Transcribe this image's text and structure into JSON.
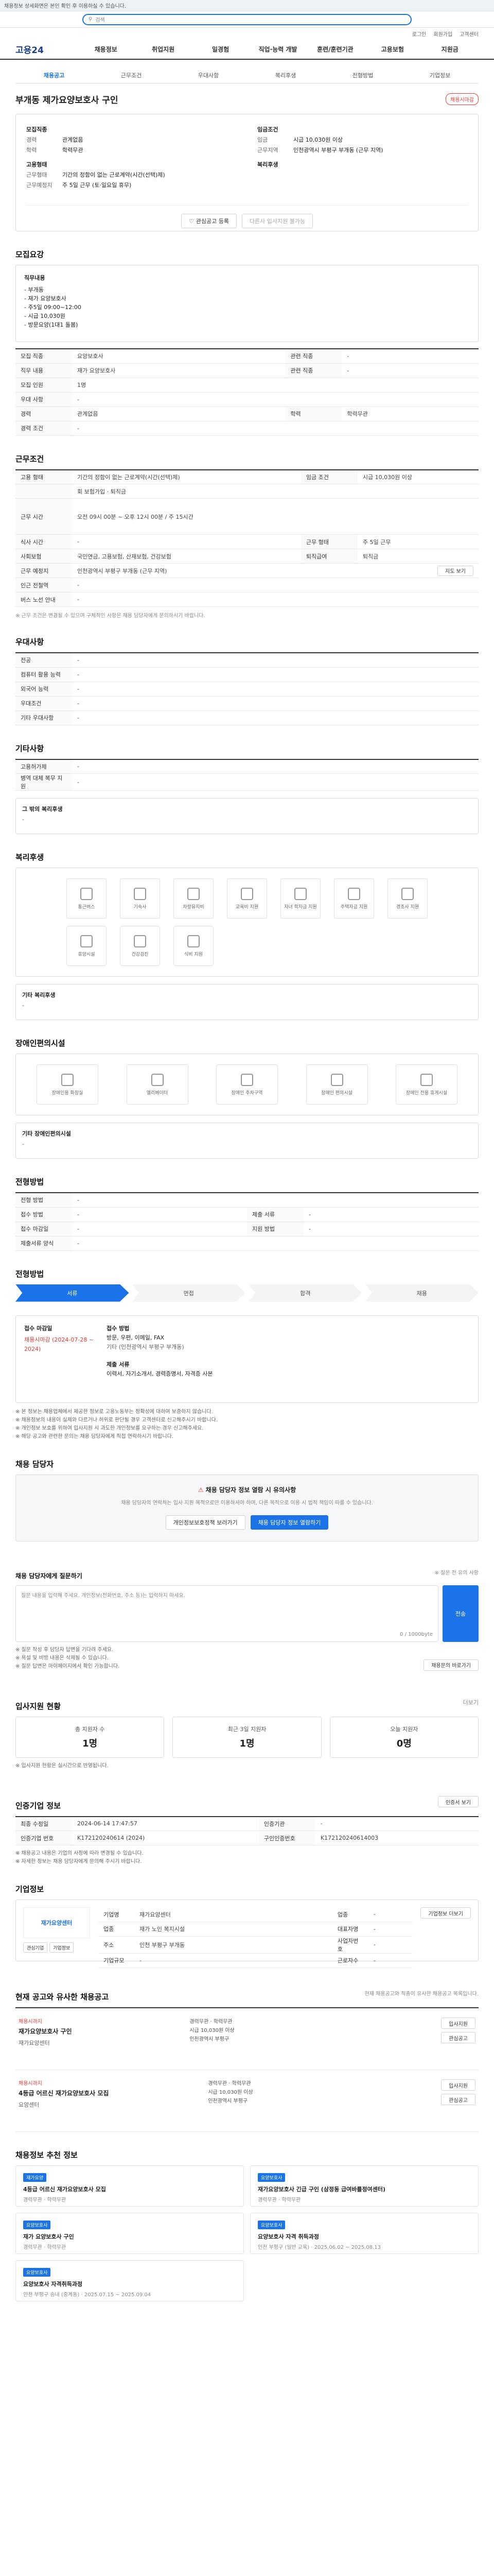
{
  "notice": {
    "text": "채용정보 상세화면은 본인 확인 후 이용하실 수 있습니다."
  },
  "search": {
    "placeholder": "검색"
  },
  "util": {
    "items": [
      "로그인",
      "회원가입",
      "고객센터"
    ]
  },
  "gnb": {
    "logo": "고용24",
    "items": [
      "채용정보",
      "취업지원",
      "일경험",
      "직업·능력 개발",
      "훈련/훈련기관",
      "고용보험",
      "지원금"
    ]
  },
  "header": {
    "tabs": [
      "채용공고",
      "근무조건",
      "우대사항",
      "복리후생",
      "전형방법",
      "기업정보"
    ],
    "status": "채용시마감",
    "title": "부개동 제가요양보호사 구인"
  },
  "summary": {
    "left": [
      {
        "k": "모집직종",
        "v": ""
      },
      {
        "k": "경력",
        "v": "관계없음"
      },
      {
        "k": "학력",
        "v": "학력무관"
      },
      {
        "k": "고용형태",
        "v": ""
      },
      {
        "k": "근무형태",
        "v": "기간의 정함이 없는 근로계약(시간(선택)제)"
      },
      {
        "k": "근무예정지",
        "v": "주 5일 근무 (토·일요일 휴무)"
      }
    ],
    "right": [
      {
        "k": "임금조건",
        "v": ""
      },
      {
        "k": "임금",
        "v": "시급 10,030원 이상"
      },
      {
        "k": "근무지역",
        "v": "인천광역시 부평구 부개동 (근무 지역)"
      },
      {
        "k": "복리후생",
        "v": ""
      }
    ],
    "scrap": "관심공고 등록",
    "share": "다른사 입사지원 불가능"
  },
  "recruit": {
    "title": "모집요강",
    "desc_label": "직무내용",
    "desc_lines": [
      "- 부개동",
      "- 재가 요양보호사",
      "- 주5일 09:00~12:00",
      "- 시급 10,030원",
      "- 방문요양(1대1 돌봄)"
    ],
    "rows": [
      {
        "k": "모집 직종",
        "v": "요양보호사",
        "k2": "관련 직종",
        "v2": "-"
      },
      {
        "k": "직무 내용",
        "v": "재가 요양보호사",
        "k2": "관련 직종",
        "v2": "-"
      },
      {
        "k": "모집 인원",
        "v": "1명"
      },
      {
        "k": "우대 사항",
        "v": "-"
      },
      {
        "k": "경력",
        "v": "관계없음",
        "k2": "학력",
        "v2": "학력무관"
      },
      {
        "k": "경력 조건",
        "v": "-"
      }
    ]
  },
  "conditions": {
    "title": "근무조건",
    "rows": [
      {
        "k": "고용 형태",
        "v": "기간의 정함이 없는 근로계약(시간(선택)제)",
        "k2": "임금 조건",
        "v2": "시급 10,030원 이상"
      },
      {
        "k": "",
        "v": "회 보험가입 · 퇴직금"
      },
      {
        "k": "근무 시간",
        "v": "오전 09시 00분 ~ 오후 12시 00분 / 주 15시간"
      },
      {
        "k": "",
        "v": ""
      },
      {
        "k": "식사 시간",
        "v": "-",
        "k2": "근무 형태",
        "v2": "주 5일 근무"
      },
      {
        "k": "사회보험",
        "v": "국민연금, 고용보험, 산재보험, 건강보험",
        "k2": "퇴직급여",
        "v2": "퇴직금"
      },
      {
        "k": "근무 예정지",
        "v": "인천광역시 부평구 부개동 (근무 지역)",
        "k2": "",
        "v2": "지도 보기"
      },
      {
        "k": "인근 전철역",
        "v": "-"
      },
      {
        "k": "버스 노선 안내",
        "v": "-"
      }
    ],
    "note": "※ 근무 조건은 변경될 수 있으며 구체적인 사항은 채용 담당자에게 문의하시기 바랍니다."
  },
  "prefer": {
    "title": "우대사항",
    "rows": [
      {
        "k": "전공",
        "v": "-"
      },
      {
        "k": "컴퓨터 활용 능력",
        "v": "-"
      },
      {
        "k": "외국어 능력",
        "v": "-"
      },
      {
        "k": "우대조건",
        "v": "-"
      },
      {
        "k": "기타 우대사항",
        "v": "-"
      }
    ]
  },
  "extra": {
    "title": "기타사항",
    "rows": [
      {
        "k": "고용허가제",
        "v": "-"
      },
      {
        "k": "병역 대체 복무 지원",
        "v": "-"
      }
    ]
  },
  "other": {
    "label": "그 밖의 복리후생",
    "v": "-"
  },
  "welfare": {
    "title": "복리후생",
    "items": [
      "통근버스",
      "기숙사",
      "차량유지비",
      "교육비 지원",
      "자녀 학자금 지원",
      "주택자금 지원",
      "경조사 지원",
      "휴양시설",
      "건강검진",
      "식비 지원"
    ]
  },
  "welfare_extra": {
    "label": "기타 복리후생",
    "v": "-"
  },
  "disabled": {
    "title": "장애인편의시설",
    "items": [
      "장애인용 화장실",
      "엘리베이터",
      "장애인 주차구역",
      "장애인 편의시설",
      "장애인 전용 휴게시설"
    ],
    "label": "기타 장애인편의시설",
    "v": "-"
  },
  "method": {
    "title": "전형방법",
    "rows": [
      {
        "k": "전형 방법",
        "v": "-"
      },
      {
        "k": "접수 방법",
        "v": "-",
        "k2": "제출 서류",
        "v2": "-"
      },
      {
        "k": "접수 마감일",
        "v": "-",
        "k2": "지원 방법",
        "v2": "-"
      },
      {
        "k": "제출서류 양식",
        "v": "-"
      }
    ]
  },
  "process": {
    "title": "전형방법",
    "steps": [
      "서류",
      "면접",
      "합격",
      "채용"
    ]
  },
  "deadline": {
    "label": "접수 마감일",
    "date": "채용시마감 (2024-07-28 ~ 2024)",
    "method_label": "접수 방법",
    "method": "방문, 우편, 이메일, FAX",
    "sub": "기타 (인천광역시 부평구 부개동)",
    "docs_label": "제출 서류",
    "docs": "이력서, 자기소개서, 경력증명서, 자격증 사본"
  },
  "notes": [
    "※ 본 정보는 채용업체에서 제공한 정보로 고용노동부는 정확성에 대하여 보증하지 않습니다.",
    "※ 채용정보의 내용이 실제와 다르거나 허위로 판단될 경우 고객센터로 신고해주시기 바랍니다.",
    "※ 개인정보 보호를 위하여 입사지원 시 과도한 개인정보를 요구하는 경우 신고해주세요.",
    "※ 해당 공고와 관련한 문의는 채용 담당자에게 직접 연락하시기 바랍니다."
  ],
  "contact": {
    "title": "채용 담당자",
    "banner": "채용 담당자 정보 열람 시 유의사항",
    "desc": "채용 담당자의 연락처는 입사 지원 목적으로만 이용하셔야 하며, 다른 목적으로 이용 시 법적 책임이 따를 수 있습니다.",
    "btn1": "개인정보보호정책 보러가기",
    "btn2": "채용 담당자 정보 열람하기"
  },
  "inquiry": {
    "title": "채용 담당자에게 질문하기",
    "hint": "※ 질문 전 유의 사항",
    "placeholder": "질문 내용을 입력해 주세요. 개인정보(전화번호, 주소 등)는 입력하지 마세요.",
    "counter": "0 / 1000byte",
    "submit": "전송",
    "notes": [
      "※ 질문 작성 후 담당자 답변을 기다려 주세요.",
      "※ 욕설 및 비방 내용은 삭제될 수 있습니다.",
      "※ 질문 답변은 마이페이지에서 확인 가능합니다."
    ],
    "more": "채용문의 바로가기"
  },
  "stats": {
    "title": "입사지원 현황",
    "more": "더보기",
    "items": [
      {
        "label": "총 지원자 수",
        "value": "1명"
      },
      {
        "label": "최근 3일 지원자",
        "value": "1명"
      },
      {
        "label": "오늘 지원자",
        "value": "0명"
      }
    ],
    "note": "※ 입사지원 현황은 실시간으로 반영됩니다."
  },
  "meta": {
    "title": "인증기업 정보",
    "btn": "인증서 보기",
    "rows": [
      {
        "k": "최종 수정일",
        "v": "2024-06-14 17:47:57",
        "k2": "인증기관",
        "v2": "-"
      },
      {
        "k": "인증기업 번호",
        "v": "K172120240614 (2024)",
        "k2": "구인인증번호",
        "v2": "K172120240614003"
      }
    ],
    "notes": [
      "※ 채용공고 내용은 기업의 사정에 따라 변경될 수 있습니다.",
      "※ 자세한 정보는 채용 담당자에게 문의해 주시기 바랍니다."
    ]
  },
  "company": {
    "title": "기업정보",
    "name": "재가요양센터",
    "rows": [
      {
        "k": "기업명",
        "v": "재가요양센터",
        "k2": "업종",
        "v2": "-"
      },
      {
        "k": "업종",
        "v": "재가 노인 복지시설",
        "k2": "대표자명",
        "v2": "-"
      },
      {
        "k": "주소",
        "v": "인천 부평구 부개동",
        "k2": "사업자번호",
        "v2": "-"
      },
      {
        "k": "기업규모",
        "v": "-",
        "k2": "근로자수",
        "v2": "-"
      }
    ],
    "btn": "기업정보 더보기",
    "btn_a": "관심기업",
    "btn_b": "기업정보"
  },
  "related": {
    "title": "현재 공고와 유사한 채용공고",
    "note": "현재 채용공고와 직종이 유사한 채용공고 목록입니다.",
    "items": [
      {
        "status": "채용시까지",
        "title": "재가요양보호사 구인",
        "co": "재가요양센터",
        "a": "경력무관",
        "b": "학력무관",
        "c": "시급 10,030원 이상",
        "loc": "인천광역시 부평구",
        "btn1": "입사지원",
        "btn2": "관심공고"
      },
      {
        "status": "채용시까지",
        "title": "4등급 어르신 재가요양보호사 모집",
        "co": "요양센터",
        "a": "경력무관",
        "b": "학력무관",
        "c": "시급 10,030원 이상",
        "loc": "인천광역시 부평구",
        "btn1": "입사지원",
        "btn2": "관심공고"
      }
    ]
  },
  "relevant": {
    "title": "채용정보 추천 정보",
    "items": [
      {
        "tag": "재가요양",
        "title": "4등급 어르신 재가요양보호사 모집",
        "a": "경력무관",
        "b": "학력무관"
      },
      {
        "tag": "요양보호사",
        "title": "재가요양보호사 긴급 구인 (삼정동 급여바를정여센터)",
        "a": "경력무관",
        "b": "학력무관"
      },
      {
        "tag": "요양보호사",
        "title": "재가 요양보호사 구인",
        "a": "경력무관",
        "b": "학력무관"
      },
      {
        "tag": "요양보호사",
        "title": "요양보호사 자격 취득과정",
        "a": "인천 부평구 (일반 교육)",
        "b": "2025.06.02 ~ 2025.08.13"
      }
    ],
    "single": {
      "tag": "요양보호사",
      "title": "요양보호사 자격취득과정",
      "a": "인천 부평구 송내 (중계동)",
      "b": "2025.07.15 ~ 2025.09.04"
    }
  }
}
